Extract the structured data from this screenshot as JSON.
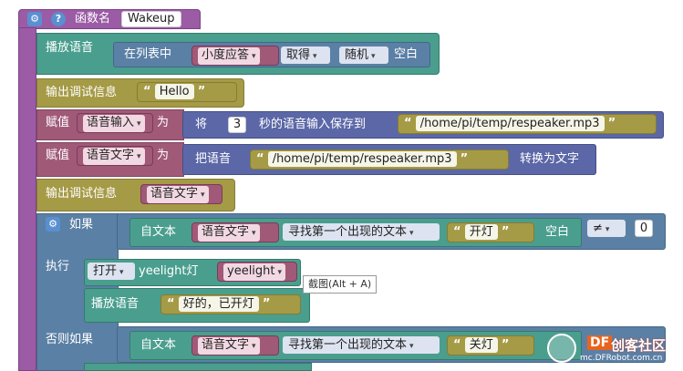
{
  "function_block": {
    "label": "函数名",
    "name": "Wakeup"
  },
  "play1": {
    "label": "播放语音",
    "list_prefix": "在列表中",
    "list_var": "小度应答",
    "get_op": "取得",
    "mode": "随机",
    "suffix": "空白"
  },
  "debug1": {
    "label": "输出调试信息",
    "text": "Hello",
    "quote_open": "“",
    "quote_close": "”"
  },
  "assign1": {
    "label": "赋值",
    "var": "语音输入",
    "as_label": "为",
    "prefix": "将",
    "seconds": "3",
    "mid": "秒的语音输入保存到",
    "path": "/home/pi/temp/respeaker.mp3"
  },
  "assign2": {
    "label": "赋值",
    "var": "语音文字",
    "as_label": "为",
    "prefix": "把语音",
    "path": "/home/pi/temp/respeaker.mp3",
    "suffix": "转换为文字"
  },
  "debug2": {
    "label": "输出调试信息",
    "var": "语音文字"
  },
  "if_block": {
    "if_label": "如果",
    "then_label": "执行",
    "elseif_label": "否则如果",
    "cond1": {
      "from_text": "自文本",
      "var": "语音文字",
      "find_op": "寻找第一个出现的文本",
      "needle": "开灯",
      "suffix": "空白",
      "compare": "≠",
      "number": "0"
    },
    "cond2": {
      "from_text": "自文本",
      "var": "语音文字",
      "find_op": "寻找第一个出现的文本",
      "needle": "关灯"
    }
  },
  "then_blocks": {
    "yeelight": {
      "state": "打开",
      "label": "yeelight灯",
      "var": "yeelight"
    },
    "play2": {
      "label": "播放语音",
      "text": "好的，已开灯"
    }
  },
  "tooltip": "截图(Alt + A)",
  "watermark": {
    "logo": "DF",
    "name": "创客社区",
    "url": "mc.DFRobot.com.cn"
  },
  "colors": {
    "function": "#9b5ba5",
    "teal": "#4a9e8e",
    "olive": "#a59a46",
    "mauve": "#a05a78",
    "indigo": "#5b67a6",
    "control": "#5b80a5"
  }
}
